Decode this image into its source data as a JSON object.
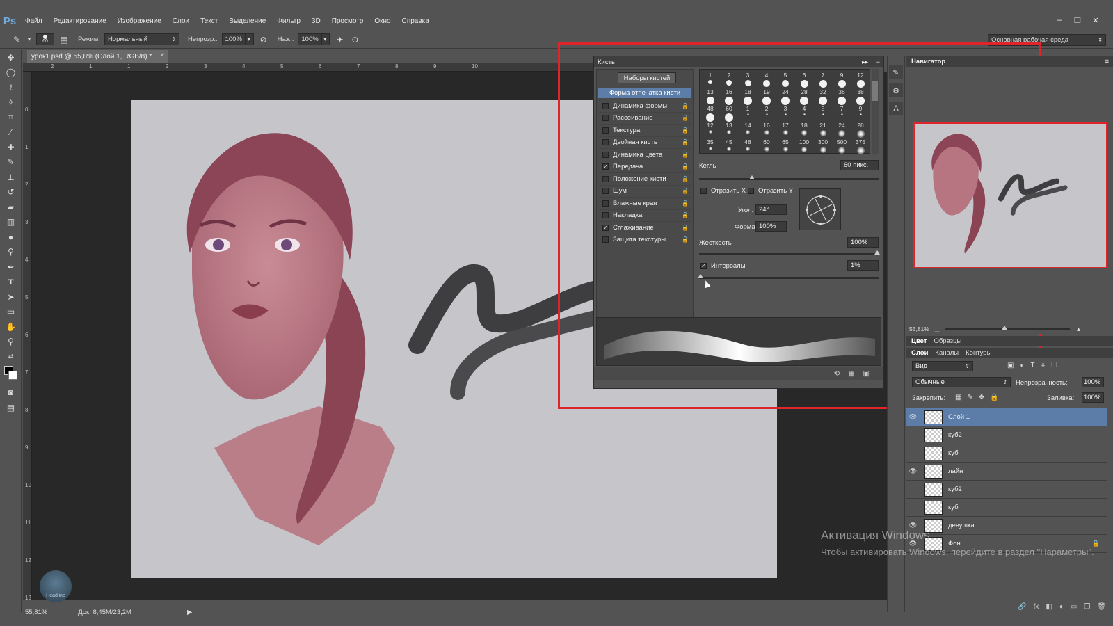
{
  "app": {
    "logo": "Ps"
  },
  "menu": [
    "Файл",
    "Редактирование",
    "Изображение",
    "Слои",
    "Текст",
    "Выделение",
    "Фильтр",
    "3D",
    "Просмотр",
    "Окно",
    "Справка"
  ],
  "window_buttons": [
    "–",
    "❐",
    "✕"
  ],
  "options_bar": {
    "brush_size": "60",
    "mode_label": "Режим:",
    "mode_value": "Нормальный",
    "opacity_label": "Непрозр.:",
    "opacity_value": "100%",
    "flow_label": "Наж.:",
    "flow_value": "100%",
    "workspace": "Основная рабочая среда"
  },
  "document": {
    "tab_title": "урок1.psd @ 55,8% (Слой 1, RGB/8) *",
    "close": "×",
    "ruler_top": [
      "2",
      "1",
      "1",
      "2",
      "3",
      "4",
      "5",
      "6",
      "7",
      "8",
      "9",
      "10"
    ],
    "ruler_left": [
      "0",
      "1",
      "2",
      "3",
      "4",
      "5",
      "6",
      "7",
      "8",
      "9",
      "10",
      "11",
      "12",
      "13"
    ]
  },
  "status": {
    "zoom": "55,81%",
    "doc": "Док: 8,45M/23,2M"
  },
  "brush_panel": {
    "title": "Кисть",
    "presets_button": "Наборы кистей",
    "tip_shape": "Форма отпечатка кисти",
    "options": [
      {
        "label": "Динамика формы",
        "checked": false
      },
      {
        "label": "Рассеивание",
        "checked": false
      },
      {
        "label": "Текстура",
        "checked": false
      },
      {
        "label": "Двойная кисть",
        "checked": false
      },
      {
        "label": "Динамика цвета",
        "checked": false
      },
      {
        "label": "Передача",
        "checked": true
      },
      {
        "label": "Положение кисти",
        "checked": false
      },
      {
        "label": "Шум",
        "checked": false
      },
      {
        "label": "Влажные края",
        "checked": false
      },
      {
        "label": "Накладка",
        "checked": false
      },
      {
        "label": "Сглаживание",
        "checked": true
      },
      {
        "label": "Защита текстуры",
        "checked": false
      }
    ],
    "tip_rows": [
      {
        "sizes": [
          "1",
          "2",
          "3",
          "4",
          "5",
          "6",
          "7",
          "9",
          "12"
        ],
        "kind": "hard"
      },
      {
        "sizes": [
          "13",
          "16",
          "18",
          "19",
          "24",
          "28",
          "32",
          "36",
          "38"
        ],
        "kind": "hard"
      },
      {
        "sizes": [
          "48",
          "60",
          "1",
          "2",
          "3",
          "4",
          "5",
          "7",
          "9"
        ],
        "kind": "mixed"
      },
      {
        "sizes": [
          "12",
          "13",
          "14",
          "16",
          "17",
          "18",
          "21",
          "24",
          "28"
        ],
        "kind": "soft"
      },
      {
        "sizes": [
          "35",
          "45",
          "48",
          "60",
          "65",
          "100",
          "300",
          "500",
          "375"
        ],
        "kind": "soft"
      }
    ],
    "size_label": "Кегль",
    "size_value": "60 пикс.",
    "flip_x": "Отразить X",
    "flip_y": "Отразить Y",
    "angle_label": "Угол:",
    "angle_value": "24°",
    "roundness_label": "Форма:",
    "roundness_value": "100%",
    "hardness_label": "Жесткость",
    "hardness_value": "100%",
    "spacing_label": "Интервалы",
    "spacing_checked": true,
    "spacing_value": "1%",
    "footer_icons": [
      "⟲",
      "▦",
      "▣"
    ]
  },
  "navigator": {
    "title": "Навигатор",
    "zoom": "55,81%"
  },
  "color_tabs": [
    "Цвет",
    "Образцы"
  ],
  "layers_tabs": [
    "Слои",
    "Каналы",
    "Контуры"
  ],
  "layers": {
    "filter": "Вид",
    "blend": "Обычные",
    "opacity_label": "Непрозрачность:",
    "opacity_value": "100%",
    "lock_label": "Закрепить:",
    "fill_label": "Заливка:",
    "fill_value": "100%",
    "items": [
      {
        "name": "Слой 1",
        "visible": true,
        "active": true
      },
      {
        "name": "куб2",
        "visible": false,
        "active": false
      },
      {
        "name": "куб",
        "visible": false,
        "active": false
      },
      {
        "name": "лайн",
        "visible": true,
        "active": false
      },
      {
        "name": "куб2",
        "visible": false,
        "active": false
      },
      {
        "name": "куб",
        "visible": false,
        "active": false
      },
      {
        "name": "девушка",
        "visible": true,
        "active": false
      },
      {
        "name": "Фон",
        "visible": true,
        "active": false
      }
    ],
    "footer_icons": [
      "🔗",
      "fx",
      "◧",
      "◐",
      "▭",
      "❐",
      "🗑"
    ]
  },
  "activation": {
    "title": "Активация Windows",
    "text": "Чтобы активировать Windows, перейдите в раздел \"Параметры\"."
  },
  "watermark": "Headline",
  "colors": {
    "highlight": "#e0242b",
    "selected": "#5c7da8"
  }
}
